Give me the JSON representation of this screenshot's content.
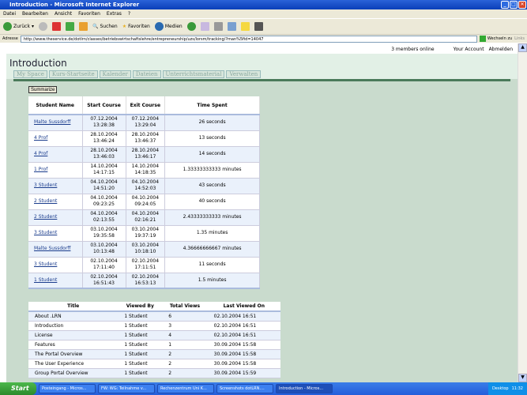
{
  "window": {
    "title": "Introduction - Microsoft Internet Explorer"
  },
  "menu": [
    "Datei",
    "Bearbeiten",
    "Ansicht",
    "Favoriten",
    "Extras",
    "?"
  ],
  "toolbar": {
    "back": "Zurück",
    "search": "Suchen",
    "favorites": "Favoriten",
    "media": "Medien"
  },
  "address": {
    "label": "Adresse",
    "url": "http://www.theservice.de/dotlrn/classes/betriebswirtschaftslehre/entrepreneurship/uzs/lorsm/tracking/?man%5fid=14047",
    "go": "Wechseln zu",
    "links": "Links"
  },
  "top": {
    "online": "3 members online",
    "account": "Your Account",
    "logout": "Abmelden"
  },
  "page": {
    "title": "Introduction",
    "tabs": [
      "My Space",
      "Kurs-Startseite",
      "Kalender",
      "Dateien",
      "Unterrichtsmaterial",
      "Verwalten"
    ],
    "summarize": "Summarize"
  },
  "tracking": {
    "headers": [
      "Student Name",
      "Start Course",
      "Exit Course",
      "Time Spent"
    ],
    "rows": [
      [
        "Malte Sussdorff",
        "07.12.2004",
        "13:28:38",
        "07.12.2004",
        "13:29:04",
        "26 seconds"
      ],
      [
        "4 Prof",
        "28.10.2004",
        "13:46:24",
        "28.10.2004",
        "13:46:37",
        "13 seconds"
      ],
      [
        "4 Prof",
        "28.10.2004",
        "13:46:03",
        "28.10.2004",
        "13:46:17",
        "14 seconds"
      ],
      [
        "1 Prof",
        "14.10.2004",
        "14:17:15",
        "14.10.2004",
        "14:18:35",
        "1.33333333333 minutes"
      ],
      [
        "3 Student",
        "04.10.2004",
        "14:51:20",
        "04.10.2004",
        "14:52:03",
        "43 seconds"
      ],
      [
        "2 Student",
        "04.10.2004",
        "09:23:25",
        "04.10.2004",
        "09:24:05",
        "40 seconds"
      ],
      [
        "2 Student",
        "04.10.2004",
        "02:13:55",
        "04.10.2004",
        "02:16:21",
        "2.43333333333 minutes"
      ],
      [
        "3 Student",
        "03.10.2004",
        "19:35:58",
        "03.10.2004",
        "19:37:19",
        "1.35 minutes"
      ],
      [
        "Malte Sussdorff",
        "03.10.2004",
        "10:13:48",
        "03.10.2004",
        "10:18:10",
        "4.36666666667 minutes"
      ],
      [
        "3 Student",
        "02.10.2004",
        "17:11:40",
        "02.10.2004",
        "17:11:51",
        "11 seconds"
      ],
      [
        "1 Student",
        "02.10.2004",
        "16:51:43",
        "02.10.2004",
        "16:53:13",
        "1.5 minutes"
      ]
    ]
  },
  "views": {
    "headers": [
      "Title",
      "Viewed By",
      "Total Views",
      "Last Viewed On"
    ],
    "rows": [
      [
        "About .LRN",
        "1 Student",
        "6",
        "02.10.2004 16:51"
      ],
      [
        "Introduction",
        "1 Student",
        "3",
        "02.10.2004 16:51"
      ],
      [
        "License",
        "1 Student",
        "4",
        "02.10.2004 16:51"
      ],
      [
        "Features",
        "1 Student",
        "1",
        "30.09.2004 15:58"
      ],
      [
        "The Portal Overview",
        "1 Student",
        "2",
        "30.09.2004 15:58"
      ],
      [
        "The User Experience",
        "1 Student",
        "2",
        "30.09.2004 15:58"
      ],
      [
        "Group Portal Overview",
        "1 Student",
        "2",
        "30.09.2004 15:59"
      ]
    ]
  },
  "taskbar": {
    "start": "Start",
    "tasks": [
      "Posteingang - Micros...",
      "FW: WG: Teilnahme v...",
      "Rechenzentrum Uni K...",
      "Screenshots dotLRN....",
      "Introduction - Micros..."
    ],
    "desktop": "Desktop",
    "clock": "11:32"
  }
}
